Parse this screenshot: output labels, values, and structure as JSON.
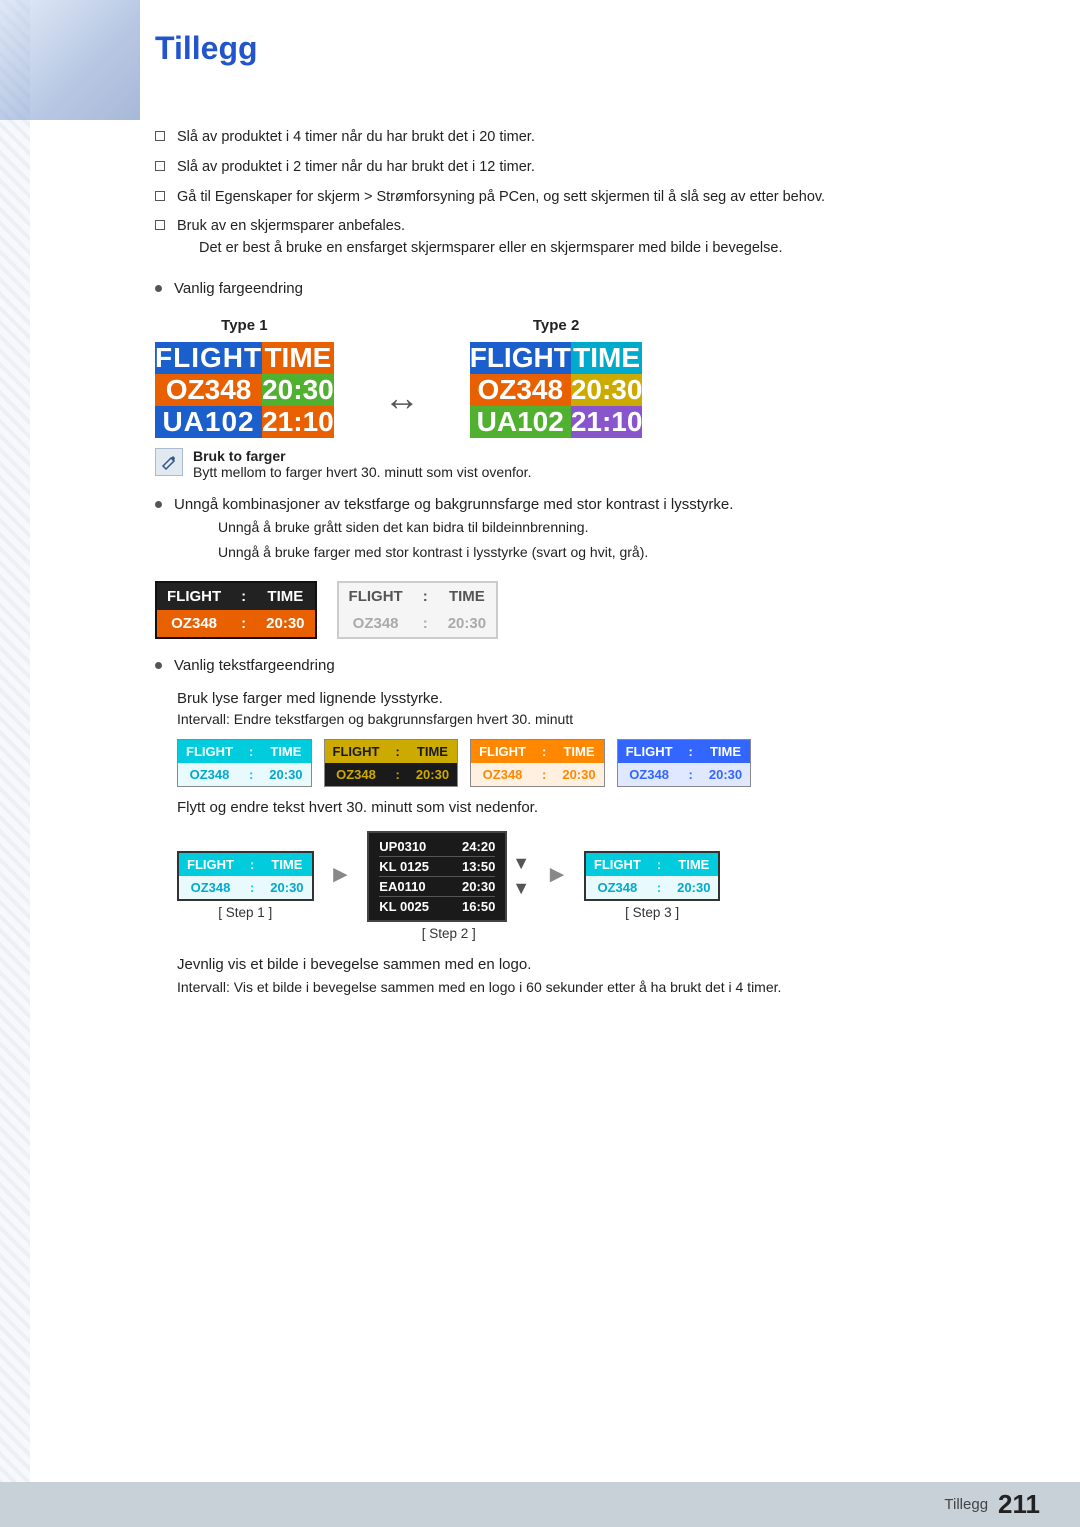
{
  "page": {
    "title": "Tillegg",
    "footer_label": "Tillegg",
    "footer_number": "211"
  },
  "bullets": {
    "item1": "Slå av produktet i 4 timer når du har brukt det i 20 timer.",
    "item2": "Slå av produktet i 2 timer når du har brukt det i 12 timer.",
    "item3": "Gå til Egenskaper for skjerm > Strømforsyning på PCen, og sett skjermen til å slå seg av etter behov.",
    "item4": "Bruk av en skjermsparer anbefales.",
    "item4_sub": "Det er best å bruke en ensfarget skjermsparer eller en skjermsparer med bilde i bevegelse."
  },
  "section_vanlig": "Vanlig fargeendring",
  "type1_label": "Type 1",
  "type2_label": "Type 2",
  "flight_cells": {
    "flight": "FLIGHT",
    "time": "TIME",
    "oz348": "OZ348",
    "t2030": "20:30",
    "ua102": "UA102",
    "t2110": "21:10"
  },
  "note_label": "Bruk to farger",
  "note_text": "Bytt mellom to farger hvert 30. minutt som vist ovenfor.",
  "bullet2_text": "Unngå kombinasjoner av tekstfarge og bakgrunnsfarge med stor kontrast i lysstyrke.",
  "bullet2_sub1": "Unngå å bruke grått siden det kan bidra til bildeinnbrenning.",
  "bullet2_sub2": "Unngå å bruke farger med stor kontrast i lysstyrke (svart og hvit, grå).",
  "small_boards": {
    "dark": {
      "header_l": "FLIGHT",
      "colon": ":",
      "header_r": "TIME",
      "row_l": "OZ348",
      "row_r": "20:30"
    },
    "light": {
      "header_l": "FLIGHT",
      "colon": ":",
      "header_r": "TIME",
      "row_l": "OZ348",
      "row_r": "20:30"
    }
  },
  "bullet3_text": "Vanlig tekstfargeendring",
  "sub_bullet3a": "Bruk lyse farger med lignende lysstyrke.",
  "sub_bullet3a_sub": "Intervall: Endre tekstfargen og bakgrunnsfargen hvert 30. minutt",
  "color_boards": [
    {
      "id": "cb1",
      "h_l": "FLIGHT",
      "h_r": "TIME",
      "r_l": "OZ348",
      "r_r": "20:30"
    },
    {
      "id": "cb2",
      "h_l": "FLIGHT",
      "h_r": "TIME",
      "r_l": "OZ348",
      "r_r": "20:30"
    },
    {
      "id": "cb3",
      "h_l": "FLIGHT",
      "h_r": "TIME",
      "r_l": "OZ348",
      "r_r": "20:30"
    },
    {
      "id": "cb4",
      "h_l": "FLIGHT",
      "h_r": "TIME",
      "r_l": "OZ348",
      "r_r": "20:30"
    }
  ],
  "sub_bullet3b": "Flytt og endre tekst hvert 30. minutt som vist nedenfor.",
  "steps": {
    "step1_label": "[ Step 1 ]",
    "step2_label": "[ Step 2 ]",
    "step3_label": "[ Step 3 ]",
    "scroll_rows": [
      {
        "left": "UP0310",
        "right": "24:20"
      },
      {
        "left": "KL 0125",
        "right": "13:50"
      },
      {
        "left": "EA0110",
        "right": "20:30"
      },
      {
        "left": "KL 0025",
        "right": "16:50"
      }
    ]
  },
  "sub_bullet3c": "Jevnlig vis et bilde i bevegelse sammen med en logo.",
  "sub_bullet3c_sub": "Intervall: Vis et bilde i bevegelse sammen med en logo i 60 sekunder etter å ha brukt det i 4 timer."
}
